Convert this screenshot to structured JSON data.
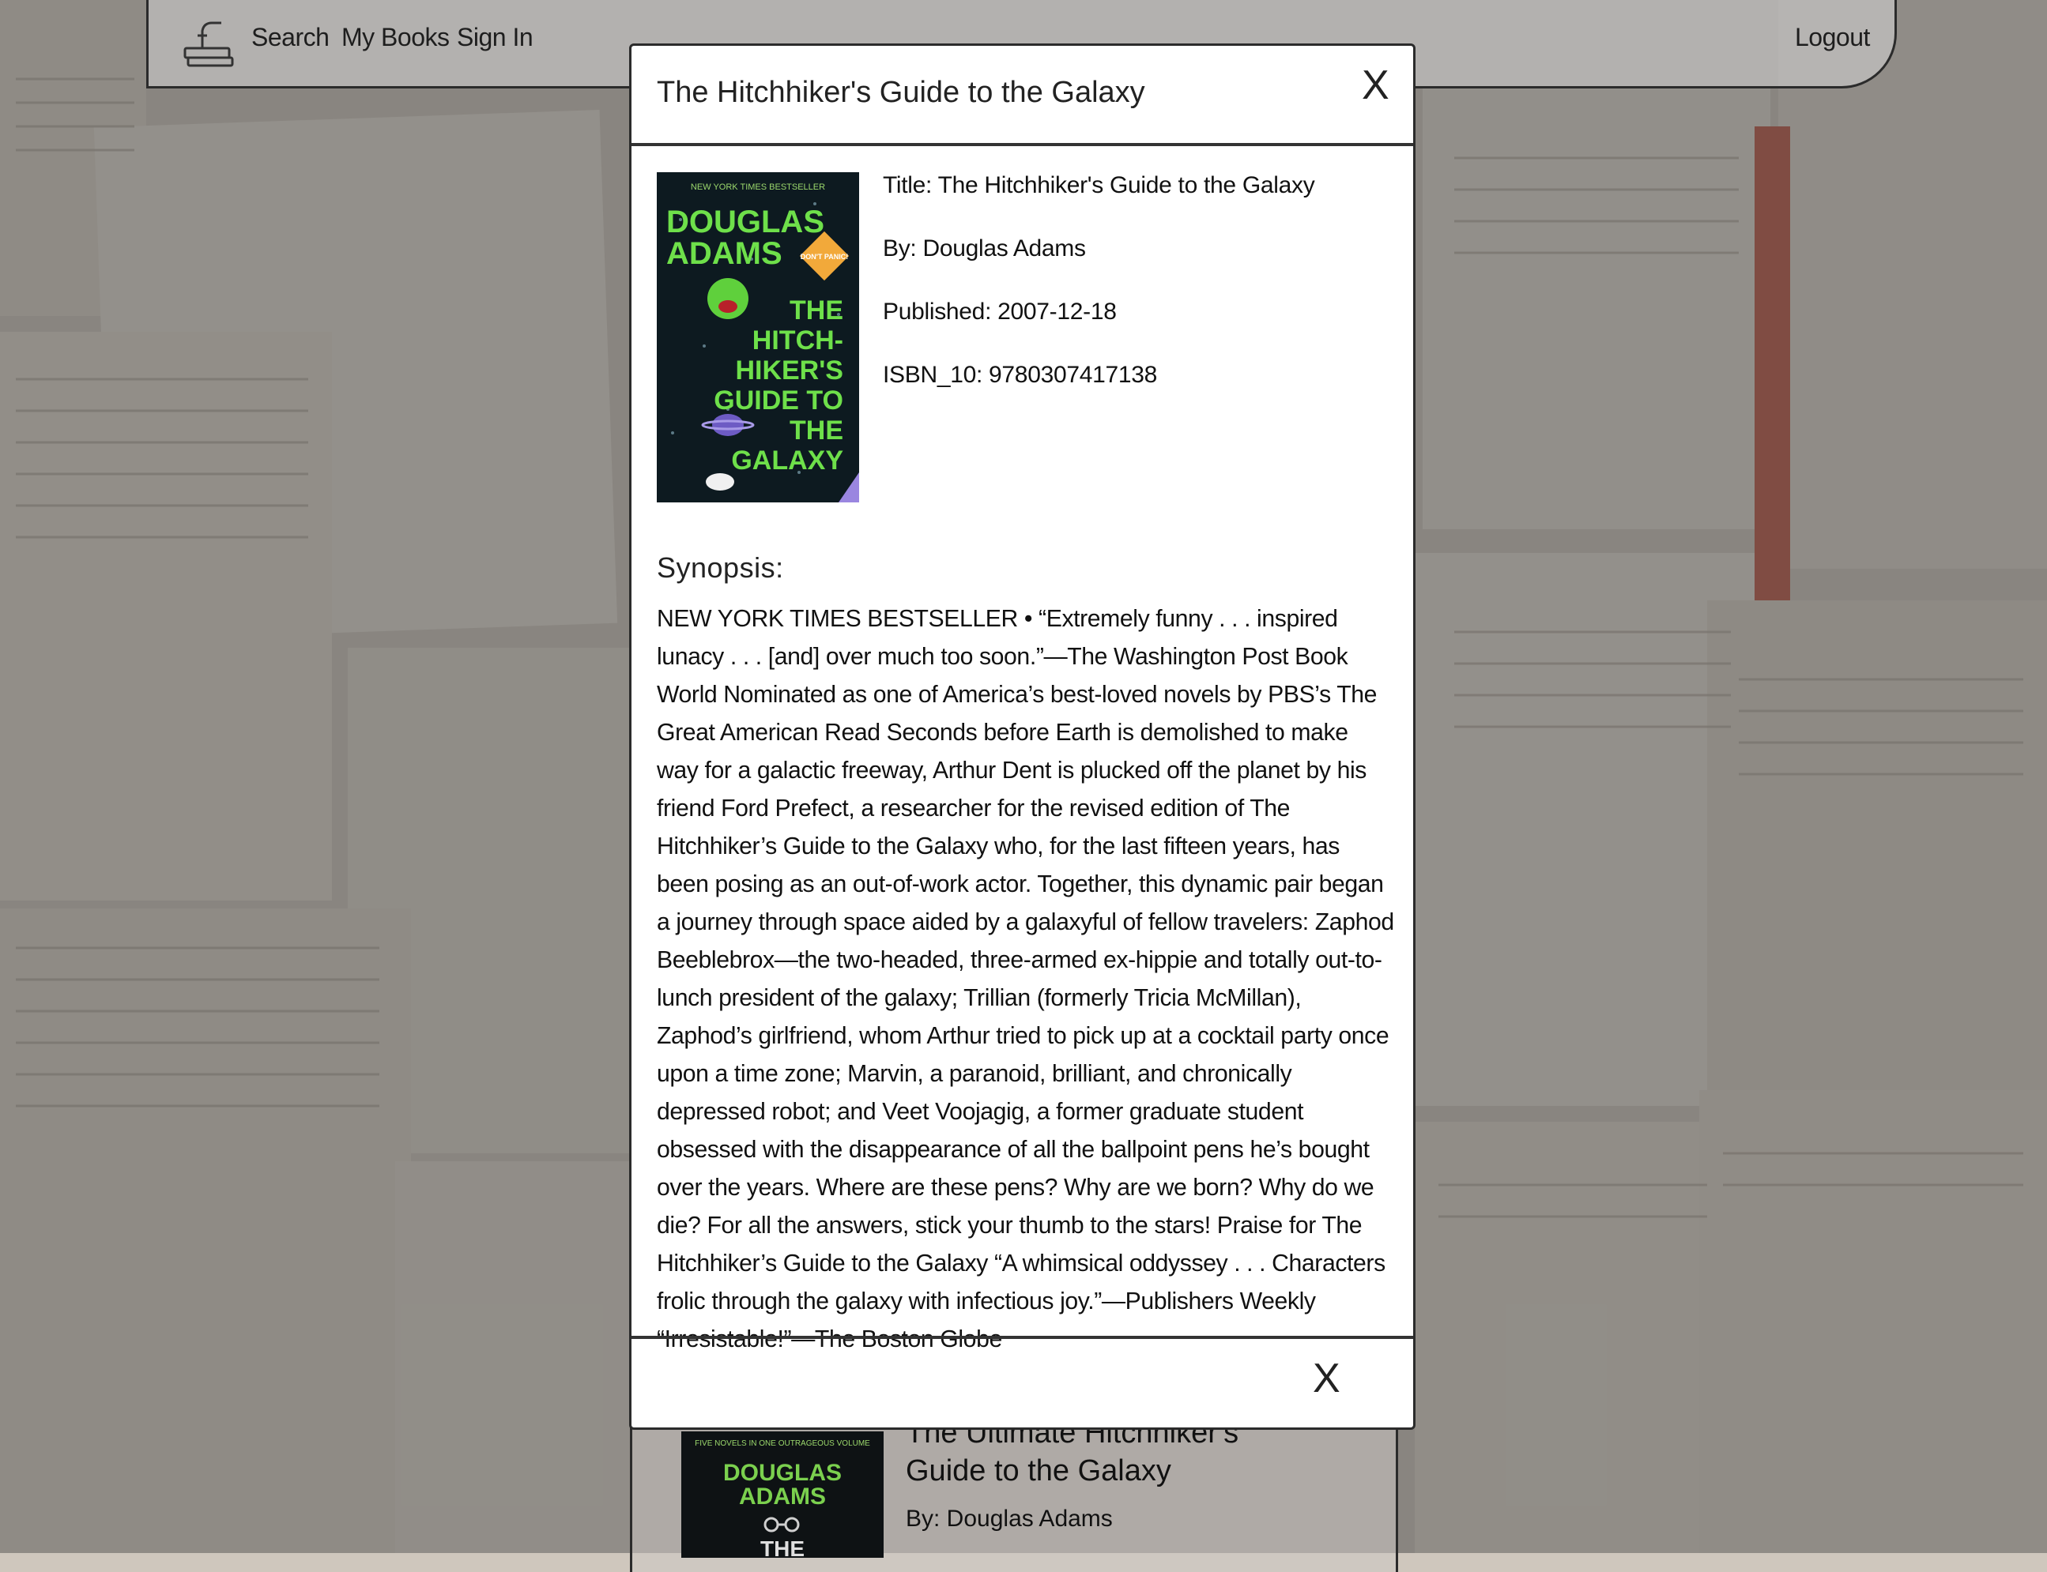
{
  "nav": {
    "items": [
      "Search",
      "My Books",
      "Sign In"
    ],
    "logout": "Logout"
  },
  "modal": {
    "title": "The Hitchhiker's Guide to the Galaxy",
    "close_label": "X",
    "details": {
      "title": "Title: The Hitchhiker's Guide to the Galaxy",
      "author": "By: Douglas Adams",
      "published": "Published: 2007-12-18",
      "isbn": "ISBN_10: 9780307417138"
    },
    "cover": {
      "top_line": "NEW YORK TIMES BESTSELLER",
      "author_line1": "DOUGLAS",
      "author_line2": "ADAMS",
      "badge": "DON'T PANIC!",
      "title_lines": [
        "THE",
        "HITCH-",
        "HIKER'S",
        "GUIDE TO",
        "THE",
        "GALAXY"
      ]
    },
    "synopsis_heading": "Synopsis:",
    "synopsis": "NEW YORK TIMES BESTSELLER • “Extremely funny . . . inspired lunacy . . . [and] over much too soon.”—The Washington Post Book World Nominated as one of America’s best-loved novels by PBS’s The Great American Read Seconds before Earth is demolished to make way for a galactic freeway, Arthur Dent is plucked off the planet by his friend Ford Prefect, a researcher for the revised edition of The Hitchhiker’s Guide to the Galaxy who, for the last fifteen years, has been posing as an out-of-work actor. Together, this dynamic pair began a journey through space aided by a galaxyful of fellow travelers: Zaphod Beeblebrox—the two-headed, three-armed ex-hippie and totally out-to-lunch president of the galaxy; Trillian (formerly Tricia McMillan), Zaphod’s girlfriend, whom Arthur tried to pick up at a cocktail party once upon a time zone; Marvin, a paranoid, brilliant, and chronically depressed robot; and Veet Voojagig, a former graduate student obsessed with the disappearance of all the ballpoint pens he’s bought over the years. Where are these pens? Why are we born? Why do we die? For all the answers, stick your thumb to the stars! Praise for The Hitchhiker’s Guide to the Galaxy “A whimsical oddyssey . . . Characters frolic through the galaxy with infectious joy.”—Publishers Weekly “Irresistable!”—The Boston Globe"
  },
  "card_behind": {
    "title": "The Ultimate Hitchhiker's Guide to the Galaxy",
    "author": "By: Douglas Adams",
    "cover_top": "FIVE NOVELS IN ONE OUTRAGEOUS VOLUME",
    "cover_author1": "DOUGLAS",
    "cover_author2": "ADAMS",
    "cover_the": "THE"
  },
  "colors": {
    "cover_bg": "#0d1a20",
    "cover_green": "#6ee04a",
    "cover_orange": "#f2a93a",
    "border": "#2b2b2b"
  }
}
